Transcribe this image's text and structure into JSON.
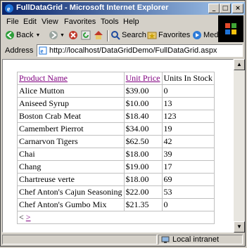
{
  "window": {
    "title": "FullDataGrid - Microsoft Internet Explorer"
  },
  "menu": [
    "File",
    "Edit",
    "View",
    "Favorites",
    "Tools",
    "Help"
  ],
  "toolbar": {
    "back_label": "Back",
    "search_label": "Search",
    "favorites_label": "Favorites",
    "media_label": "Media"
  },
  "address": {
    "label": "Address",
    "url": "http://localhost/DataGridDemo/FullDataGrid.aspx"
  },
  "grid": {
    "headers": [
      "Product Name",
      "Unit Price",
      "Units In Stock"
    ],
    "rows": [
      [
        "Alice Mutton",
        "$39.00",
        "0"
      ],
      [
        "Aniseed Syrup",
        "$10.00",
        "13"
      ],
      [
        "Boston Crab Meat",
        "$18.40",
        "123"
      ],
      [
        "Camembert Pierrot",
        "$34.00",
        "19"
      ],
      [
        "Carnarvon Tigers",
        "$62.50",
        "42"
      ],
      [
        "Chai",
        "$18.00",
        "39"
      ],
      [
        "Chang",
        "$19.00",
        "17"
      ],
      [
        "Chartreuse verte",
        "$18.00",
        "69"
      ],
      [
        "Chef Anton's Cajun Seasoning",
        "$22.00",
        "53"
      ],
      [
        "Chef Anton's Gumbo Mix",
        "$21.35",
        "0"
      ]
    ],
    "pager": {
      "prev": "<",
      "next": ">"
    }
  },
  "status": {
    "zone": "Local intranet"
  },
  "colors": {
    "titlebar": "#0a246a",
    "visited_link": "#800080",
    "link": "#0000ff"
  }
}
